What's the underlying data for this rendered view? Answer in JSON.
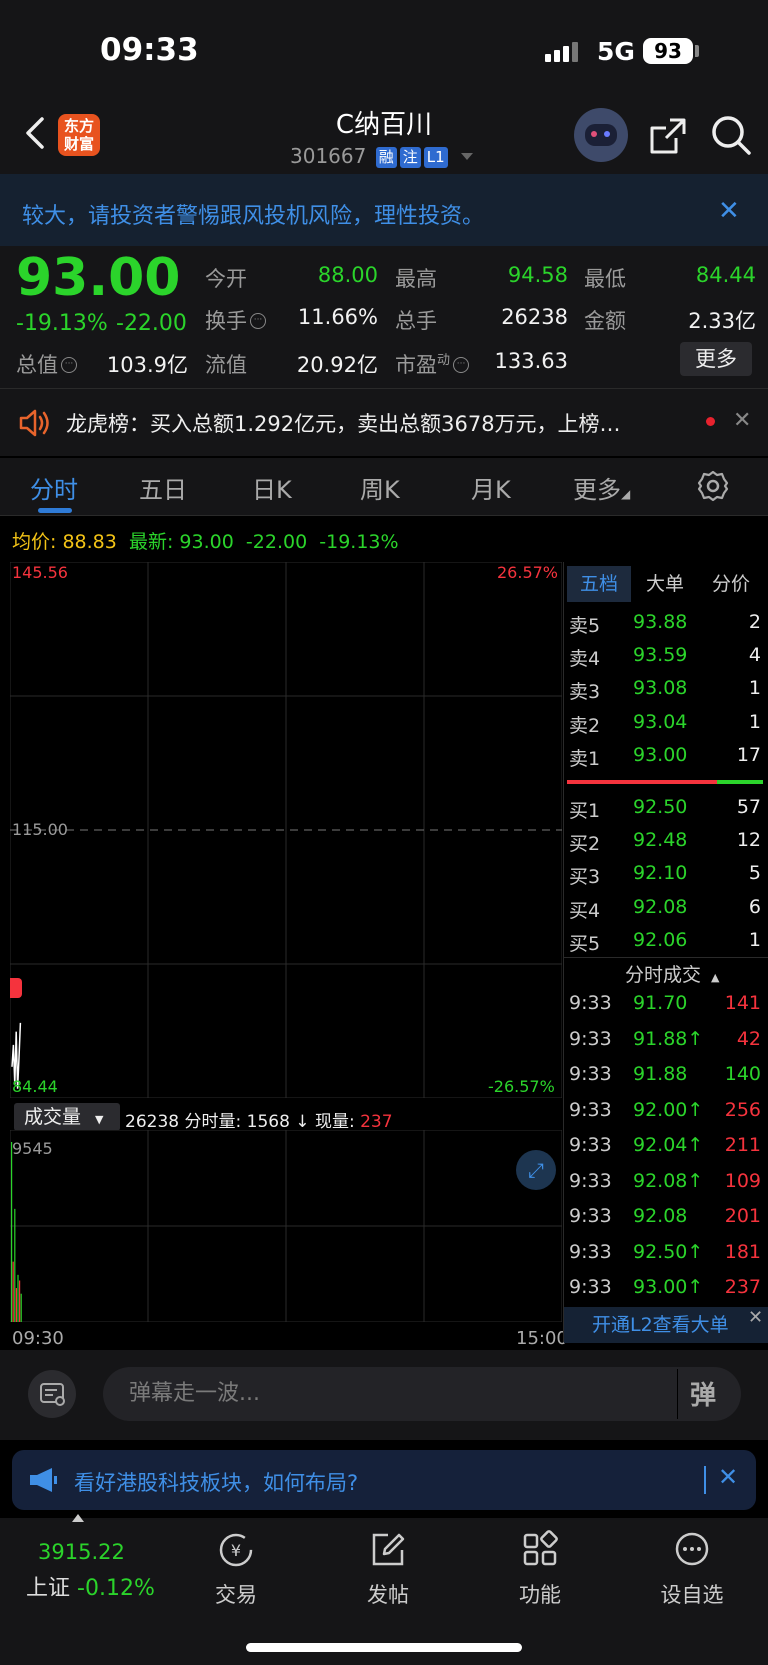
{
  "status_bar": {
    "time": "09:33",
    "network": "5G",
    "battery": "93"
  },
  "header": {
    "logo_line1": "东方",
    "logo_line2": "财富",
    "stock_name": "C纳百川",
    "stock_code": "301667",
    "tags": [
      "融",
      "注",
      "L1"
    ]
  },
  "risk_banner": {
    "text": "较大，请投资者警惕跟风投机风险，理性投资。"
  },
  "quote": {
    "price": "93.00",
    "change_pct": "-19.13%",
    "change_amt": "-22.00",
    "row1": [
      {
        "label": "今开",
        "value": "88.00",
        "color": "#2bd42b"
      },
      {
        "label": "最高",
        "value": "94.58",
        "color": "#2bd42b"
      },
      {
        "label": "最低",
        "value": "84.44",
        "color": "#2bd42b"
      }
    ],
    "row2": [
      {
        "label": "换手",
        "value": "11.66%",
        "color": "#eeeeee"
      },
      {
        "label": "总手",
        "value": "26238",
        "color": "#eeeeee"
      },
      {
        "label": "金额",
        "value": "2.33亿",
        "color": "#eeeeee"
      }
    ],
    "row3": [
      {
        "label": "总值",
        "value": "103.9亿"
      },
      {
        "label": "流值",
        "value": "20.92亿"
      },
      {
        "label": "市盈",
        "sup": "动",
        "value": "133.63"
      }
    ],
    "more_button": "更多"
  },
  "lhb": {
    "text": "龙虎榜：买入总额1.292亿元，卖出总额3678万元，上榜…"
  },
  "tabs": [
    "分时",
    "五日",
    "日K",
    "周K",
    "月K",
    "更多"
  ],
  "avg_line": {
    "avg_label": "均价:",
    "avg_value": "88.83",
    "latest_label": "最新:",
    "latest_value": "93.00",
    "change": "-22.00",
    "pct": "-19.13%"
  },
  "chart_data": {
    "type": "line",
    "title": "",
    "y_top_price": "145.56",
    "y_mid_price": "115.00",
    "y_bottom_price": "84.44",
    "y_top_pct": "26.57%",
    "y_bottom_pct": "-26.57%",
    "x_start": "09:30",
    "x_end": "15:00",
    "ylim": [
      84.44,
      145.56
    ],
    "series": [
      {
        "name": "",
        "values": [
          88.0,
          90.5,
          86.0,
          92.0,
          85.5,
          89.0,
          93.0
        ]
      }
    ],
    "volume": {
      "label": "成交量",
      "total": "26238",
      "period_label": "分时量:",
      "period_value": "1568",
      "current_label": "现量:",
      "current_value": "237",
      "max_label": "9545",
      "bars": [
        9545,
        3200,
        6000,
        1800,
        2500,
        2200,
        1500
      ]
    }
  },
  "order_book": {
    "tabs": [
      "五档",
      "大单",
      "分价"
    ],
    "asks": [
      {
        "label": "卖5",
        "price": "93.88",
        "vol": "2"
      },
      {
        "label": "卖4",
        "price": "93.59",
        "vol": "4"
      },
      {
        "label": "卖3",
        "price": "93.08",
        "vol": "1"
      },
      {
        "label": "卖2",
        "price": "93.04",
        "vol": "1"
      },
      {
        "label": "卖1",
        "price": "93.00",
        "vol": "17"
      }
    ],
    "bids": [
      {
        "label": "买1",
        "price": "92.50",
        "vol": "57"
      },
      {
        "label": "买2",
        "price": "92.48",
        "vol": "12"
      },
      {
        "label": "买3",
        "price": "92.10",
        "vol": "5"
      },
      {
        "label": "买4",
        "price": "92.08",
        "vol": "6"
      },
      {
        "label": "买5",
        "price": "92.06",
        "vol": "1"
      }
    ],
    "trades_title": "分时成交",
    "trades": [
      {
        "time": "9:33",
        "price": "91.70",
        "arrow": "",
        "vol": "141",
        "vol_color": "#f5333d"
      },
      {
        "time": "9:33",
        "price": "91.88",
        "arrow": "↑",
        "vol": "42",
        "vol_color": "#f5333d"
      },
      {
        "time": "9:33",
        "price": "91.88",
        "arrow": "",
        "vol": "140",
        "vol_color": "#2bd42b"
      },
      {
        "time": "9:33",
        "price": "92.00",
        "arrow": "↑",
        "vol": "256",
        "vol_color": "#f5333d"
      },
      {
        "time": "9:33",
        "price": "92.04",
        "arrow": "↑",
        "vol": "211",
        "vol_color": "#f5333d"
      },
      {
        "time": "9:33",
        "price": "92.08",
        "arrow": "↑",
        "vol": "109",
        "vol_color": "#f5333d"
      },
      {
        "time": "9:33",
        "price": "92.08",
        "arrow": "",
        "vol": "201",
        "vol_color": "#f5333d"
      },
      {
        "time": "9:33",
        "price": "92.50",
        "arrow": "↑",
        "vol": "181",
        "vol_color": "#f5333d"
      },
      {
        "time": "9:33",
        "price": "93.00",
        "arrow": "↑",
        "vol": "237",
        "vol_color": "#f5333d"
      }
    ],
    "l2_link": "开通L2查看大单"
  },
  "danmu": {
    "placeholder": "弹幕走一波...",
    "send": "弹"
  },
  "promo": {
    "text": "看好港股科技板块，如何布局?"
  },
  "bottom_nav": {
    "index_value": "3915.22",
    "index_name": "上证",
    "index_change": "-0.12%",
    "items": [
      "交易",
      "发帖",
      "功能",
      "设自选"
    ]
  },
  "colors": {
    "up": "#f5333d",
    "down": "#2bd42b",
    "accent": "#3f8fe6"
  }
}
